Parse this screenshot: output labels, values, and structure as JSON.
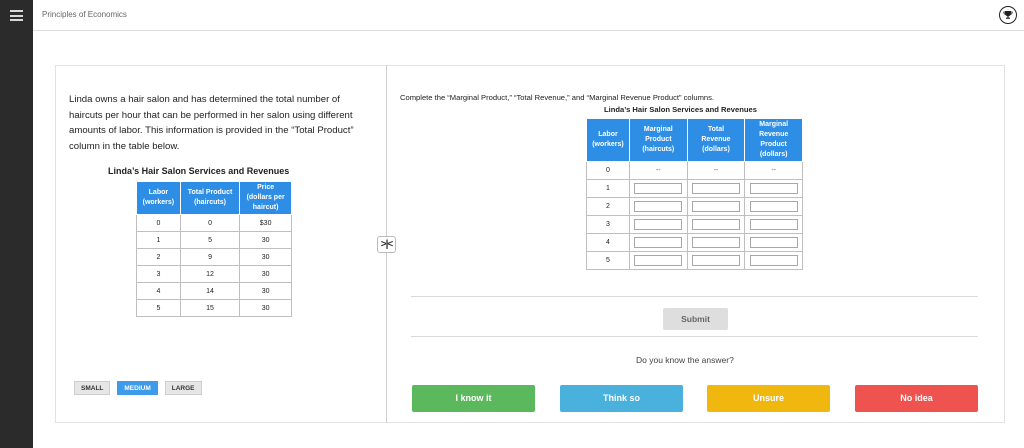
{
  "header": {
    "course_title": "Principles of Economics"
  },
  "problem": {
    "intro": "Linda owns a hair salon and has determined the total number of haircuts per hour that can be performed in her salon using different amounts of labor. This information is provided in the “Total Product” column in the table below.",
    "table_title": "Linda’s Hair Salon Services and Revenues",
    "columns": [
      [
        "Labor",
        "(workers)"
      ],
      [
        "Total Product",
        "(haircuts)"
      ],
      [
        "Price",
        "(dollars per",
        "haircut)"
      ]
    ],
    "rows": [
      [
        "0",
        "0",
        "$30"
      ],
      [
        "1",
        "5",
        "30"
      ],
      [
        "2",
        "9",
        "30"
      ],
      [
        "3",
        "12",
        "30"
      ],
      [
        "4",
        "14",
        "30"
      ],
      [
        "5",
        "15",
        "30"
      ]
    ]
  },
  "text_size": {
    "small": "SMALL",
    "medium": "MEDIUM",
    "large": "LARGE",
    "selected": "medium"
  },
  "task": {
    "instruction": "Complete the “Marginal Product,” “Total Revenue,” and “Marginal Revenue Product” columns.",
    "table_title": "Linda’s Hair Salon Services and Revenues",
    "columns": [
      [
        "Labor",
        "(workers)"
      ],
      [
        "Marginal",
        "Product",
        "(haircuts)"
      ],
      [
        "Total",
        "Revenue",
        "(dollars)"
      ],
      [
        "Marginal",
        "Revenue",
        "Product",
        "(dollars)"
      ]
    ],
    "labor_values": [
      "0",
      "1",
      "2",
      "3",
      "4",
      "5"
    ],
    "first_row_placeholder": "--",
    "inputs": [
      [
        "",
        "",
        ""
      ],
      [
        "",
        "",
        ""
      ],
      [
        "",
        "",
        ""
      ],
      [
        "",
        "",
        ""
      ],
      [
        "",
        "",
        ""
      ]
    ]
  },
  "actions": {
    "submit": "Submit",
    "question": "Do you know the answer?",
    "know": "I know it",
    "think": "Think so",
    "unsure": "Unsure",
    "no_idea": "No idea"
  },
  "colors": {
    "table_header": "#2e8ee6",
    "know": "#5cb85c",
    "think": "#4ab0dc",
    "unsure": "#f0b80e",
    "no_idea": "#ef5350"
  },
  "icons": {
    "menu": "hamburger-menu-icon",
    "trophy": "trophy-icon",
    "resize": "resize-panel-icon"
  }
}
